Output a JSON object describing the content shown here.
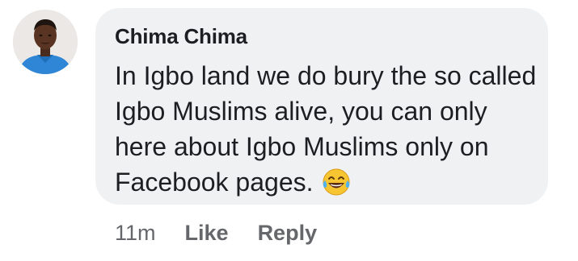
{
  "comment": {
    "author": "Chima Chima",
    "text": "In Igbo land we do bury the so called Igbo Muslims alive, you can only here about Igbo Muslims only on Facebook pages.",
    "emoji": "face-with-tears-of-joy",
    "timestamp": "11m",
    "like_label": "Like",
    "reply_label": "Reply"
  },
  "colors": {
    "bubble": "#f0f1f3",
    "text": "#1c1e21",
    "meta": "#65676b",
    "avatar_shirt": "#2f86d6"
  }
}
